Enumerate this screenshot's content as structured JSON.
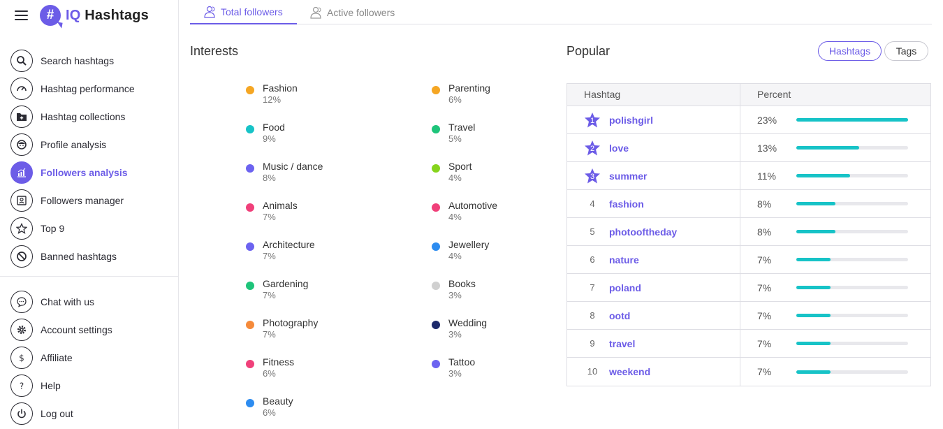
{
  "brand": {
    "iq": "IQ",
    "name": "Hashtags",
    "badge": "#"
  },
  "sidebar": {
    "items": [
      {
        "label": "Search hashtags",
        "icon": "search-icon",
        "active": false
      },
      {
        "label": "Hashtag performance",
        "icon": "gauge-icon",
        "active": false
      },
      {
        "label": "Hashtag collections",
        "icon": "folder-plus-icon",
        "active": false
      },
      {
        "label": "Profile analysis",
        "icon": "face-icon",
        "active": false
      },
      {
        "label": "Followers analysis",
        "icon": "chart-icon",
        "active": true
      },
      {
        "label": "Followers manager",
        "icon": "contact-card-icon",
        "active": false
      },
      {
        "label": "Top 9",
        "icon": "star-icon",
        "active": false
      },
      {
        "label": "Banned hashtags",
        "icon": "ban-icon",
        "active": false
      }
    ],
    "bottom_items": [
      {
        "label": "Chat with us",
        "icon": "chat-icon"
      },
      {
        "label": "Account settings",
        "icon": "gear-icon"
      },
      {
        "label": "Affiliate",
        "icon": "dollar-icon"
      },
      {
        "label": "Help",
        "icon": "question-icon"
      },
      {
        "label": "Log out",
        "icon": "power-icon"
      }
    ]
  },
  "tabs": [
    {
      "label": "Total followers",
      "active": true
    },
    {
      "label": "Active followers",
      "active": false
    }
  ],
  "interests": {
    "title": "Interests",
    "left": [
      {
        "name": "Fashion",
        "pct": "12%",
        "color": "#f5a623"
      },
      {
        "name": "Food",
        "pct": "9%",
        "color": "#17c3c7"
      },
      {
        "name": "Music / dance",
        "pct": "8%",
        "color": "#6c63f0"
      },
      {
        "name": "Animals",
        "pct": "7%",
        "color": "#f0407a"
      },
      {
        "name": "Architecture",
        "pct": "7%",
        "color": "#6c63f0"
      },
      {
        "name": "Gardening",
        "pct": "7%",
        "color": "#1ec47a"
      },
      {
        "name": "Photography",
        "pct": "7%",
        "color": "#f58a3a"
      },
      {
        "name": "Fitness",
        "pct": "6%",
        "color": "#f0407a"
      },
      {
        "name": "Beauty",
        "pct": "6%",
        "color": "#2d8cf0"
      }
    ],
    "right": [
      {
        "name": "Parenting",
        "pct": "6%",
        "color": "#f5a623"
      },
      {
        "name": "Travel",
        "pct": "5%",
        "color": "#1ec47a"
      },
      {
        "name": "Sport",
        "pct": "4%",
        "color": "#86d41c"
      },
      {
        "name": "Automotive",
        "pct": "4%",
        "color": "#f0407a"
      },
      {
        "name": "Jewellery",
        "pct": "4%",
        "color": "#2d8cf0"
      },
      {
        "name": "Books",
        "pct": "3%",
        "color": "#d0d0d0"
      },
      {
        "name": "Wedding",
        "pct": "3%",
        "color": "#1d2a6b"
      },
      {
        "name": "Tattoo",
        "pct": "3%",
        "color": "#6c63f0"
      }
    ]
  },
  "popular": {
    "title": "Popular",
    "toggle": [
      "Hashtags",
      "Tags"
    ],
    "columns": [
      "Hashtag",
      "Percent"
    ],
    "rows": [
      {
        "rank": "1",
        "tag": "polishgirl",
        "pct": "23%",
        "value": 23
      },
      {
        "rank": "2",
        "tag": "love",
        "pct": "13%",
        "value": 13
      },
      {
        "rank": "3",
        "tag": "summer",
        "pct": "11%",
        "value": 11
      },
      {
        "rank": "4",
        "tag": "fashion",
        "pct": "8%",
        "value": 8
      },
      {
        "rank": "5",
        "tag": "photooftheday",
        "pct": "8%",
        "value": 8
      },
      {
        "rank": "6",
        "tag": "nature",
        "pct": "7%",
        "value": 7
      },
      {
        "rank": "7",
        "tag": "poland",
        "pct": "7%",
        "value": 7
      },
      {
        "rank": "8",
        "tag": "ootd",
        "pct": "7%",
        "value": 7
      },
      {
        "rank": "9",
        "tag": "travel",
        "pct": "7%",
        "value": 7
      },
      {
        "rank": "10",
        "tag": "weekend",
        "pct": "7%",
        "value": 7
      }
    ]
  },
  "colors": {
    "accent": "#6c5ce7",
    "bar": "#17c3c7"
  }
}
